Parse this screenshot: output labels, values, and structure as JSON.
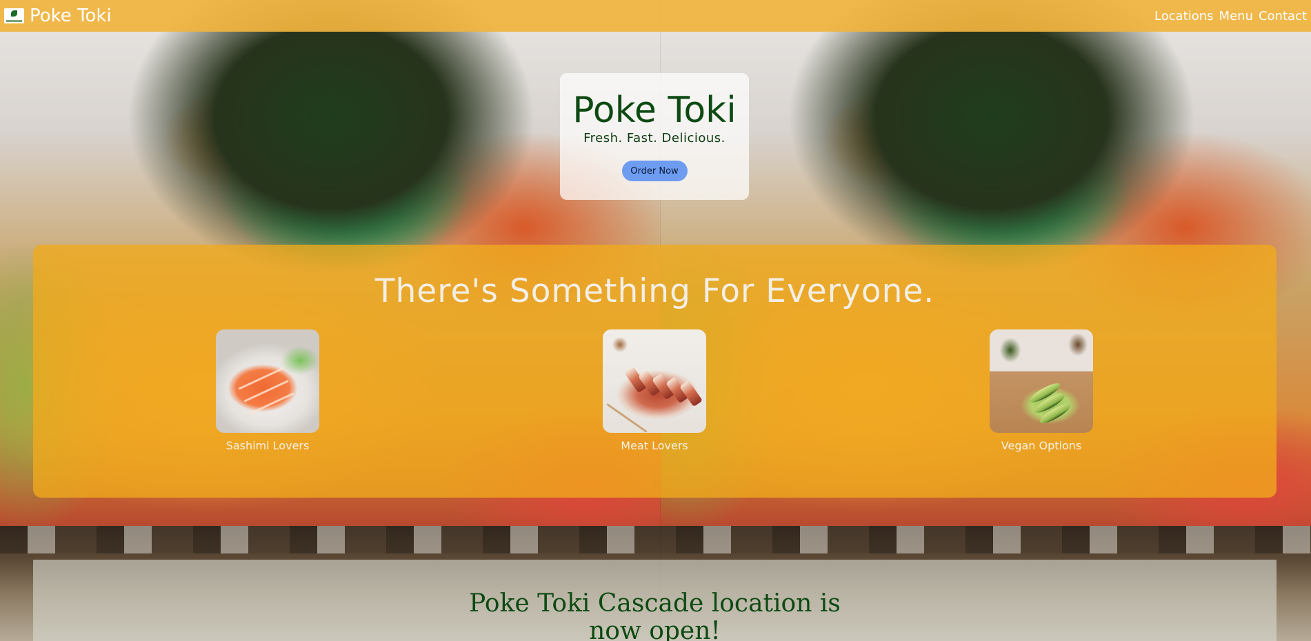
{
  "navbar": {
    "brand_name": "Poke Toki",
    "logo_icon": "poke-toki-logo-icon",
    "links": [
      {
        "label": "Locations"
      },
      {
        "label": "Menu"
      },
      {
        "label": "Contact"
      }
    ]
  },
  "hero": {
    "title": "Poke Toki",
    "subtitle": "Fresh. Fast. Delicious.",
    "cta_label": "Order Now"
  },
  "options": {
    "heading": "There's Something For Everyone.",
    "items": [
      {
        "label": "Sashimi Lovers",
        "image": "salmon-sashimi-image"
      },
      {
        "label": "Meat Lovers",
        "image": "roast-pork-image"
      },
      {
        "label": "Vegan Options",
        "image": "avocado-image"
      }
    ]
  },
  "news": {
    "title": "Poke Toki Cascade location is now open!"
  },
  "colors": {
    "navbar_bg": "#F0B43E",
    "options_panel_bg": "#F1AA1C",
    "brand_green": "#0D4A12",
    "cta_blue": "#6D9CF0"
  }
}
